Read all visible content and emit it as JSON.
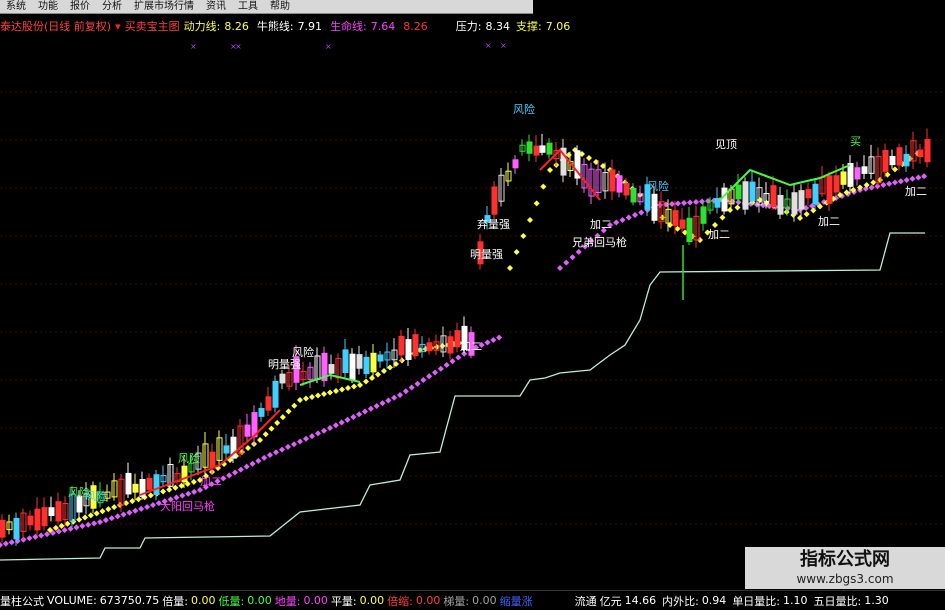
{
  "menu": [
    "系统",
    "功能",
    "报价",
    "分析",
    "扩展市场行情",
    "资讯",
    "工具",
    "帮助"
  ],
  "info": {
    "stock": "泰达股份(日线 前复权)",
    "formula": "买卖宝主图",
    "l1": "动力线:",
    "v1": "8.26",
    "l2": "牛熊线:",
    "v2": "7.91",
    "l3": "生命线:",
    "v3": "7.64",
    "v4": "8.26",
    "l5": "压力:",
    "v5": "8.34",
    "l6": "支撑:",
    "v6": "7.06"
  },
  "colors": {
    "up": "#ff3030",
    "down": "#00d0c0",
    "dots_yellow": "#ffff40",
    "dots_magenta": "#e060ff",
    "support": "#b8f0d8",
    "trend": "#ff2020",
    "trend2": "#40ff40"
  },
  "annotations": [
    {
      "text": "风险"
    },
    {
      "text": "风险"
    },
    {
      "text": "加二"
    },
    {
      "text": "大阳回马枪"
    },
    {
      "text": "明量强"
    },
    {
      "text": "风险"
    },
    {
      "text": "加二"
    },
    {
      "text": "风险"
    },
    {
      "text": "弃量强"
    },
    {
      "text": "明量强"
    },
    {
      "text": "风险"
    },
    {
      "text": "加二"
    },
    {
      "text": "兄弟回马枪"
    },
    {
      "text": "加二"
    },
    {
      "text": "加二"
    },
    {
      "text": "加二"
    },
    {
      "text": "风险"
    },
    {
      "text": "买"
    },
    {
      "text": "见顶"
    }
  ],
  "bottom": {
    "ind": "量柱公式",
    "vol_l": "VOLUME:",
    "vol_v": "673750.75",
    "b1": "倍量:",
    "b1v": "0.00",
    "b2": "低量:",
    "b2v": "0.00",
    "b3": "地量:",
    "b3v": "0.00",
    "b4": "平量:",
    "b4v": "0.00",
    "b5": "倍缩:",
    "b5v": "0.00",
    "b6": "梯量:",
    "b6v": "0.00",
    "b7": "缩量涨",
    "r1": "流通",
    "r2": "亿元",
    "r3v": "14.66",
    "r4": "内外比:",
    "r4v": "0.94",
    "r5": "单日量比:",
    "r5v": "1.10",
    "r6": "五日量比:",
    "r6v": "1.30"
  },
  "watermark": {
    "title": "指标公式网",
    "url": "www.zbgs3.com"
  }
}
